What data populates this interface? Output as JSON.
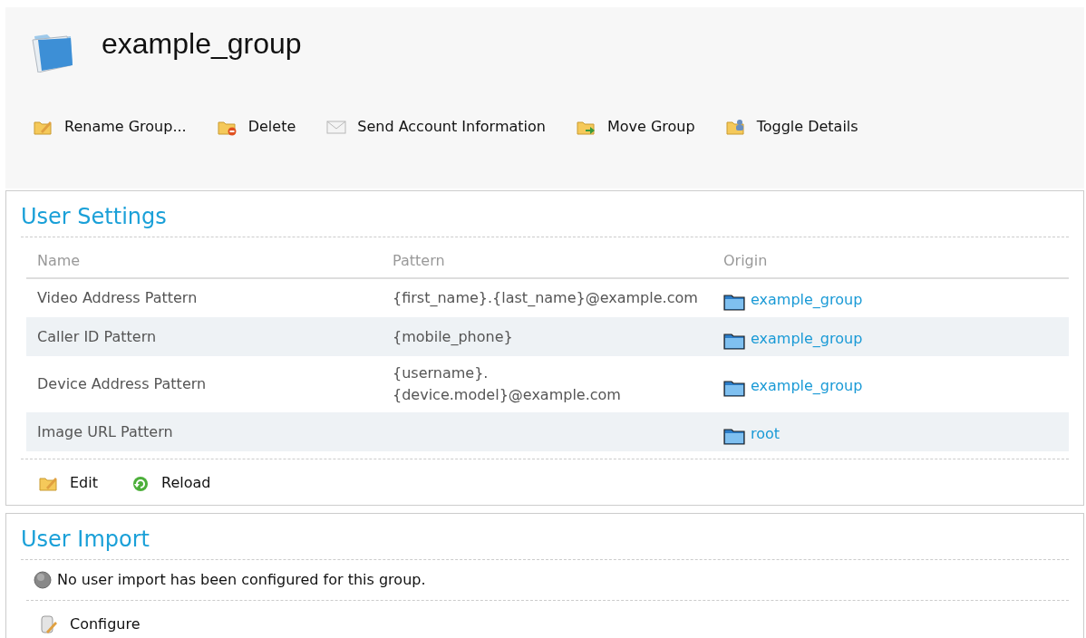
{
  "header": {
    "title": "example_group"
  },
  "toolbar": [
    {
      "label": "Rename Group...",
      "kind": "rename"
    },
    {
      "label": "Delete",
      "kind": "delete"
    },
    {
      "label": "Send Account Information",
      "kind": "mail"
    },
    {
      "label": "Move Group",
      "kind": "move"
    },
    {
      "label": "Toggle Details",
      "kind": "details"
    }
  ],
  "user_settings": {
    "title": "User Settings",
    "columns": [
      "Name",
      "Pattern",
      "Origin"
    ],
    "rows": [
      {
        "name": "Video Address Pattern",
        "pattern": [
          "{first_name}.{last_name}@example.com"
        ],
        "origin": "example_group"
      },
      {
        "name": "Caller ID Pattern",
        "pattern": [
          "{mobile_phone}"
        ],
        "origin": "example_group"
      },
      {
        "name": "Device Address Pattern",
        "pattern": [
          "{username}.",
          "{device.model}@example.com"
        ],
        "origin": "example_group"
      },
      {
        "name": "Image URL Pattern",
        "pattern": [],
        "origin": "root"
      }
    ],
    "actions": [
      {
        "label": "Edit",
        "kind": "edit"
      },
      {
        "label": "Reload",
        "kind": "reload"
      }
    ]
  },
  "user_import": {
    "title": "User Import",
    "message": "No user import has been configured for this group.",
    "actions": [
      {
        "label": "Configure",
        "kind": "configure"
      }
    ]
  }
}
